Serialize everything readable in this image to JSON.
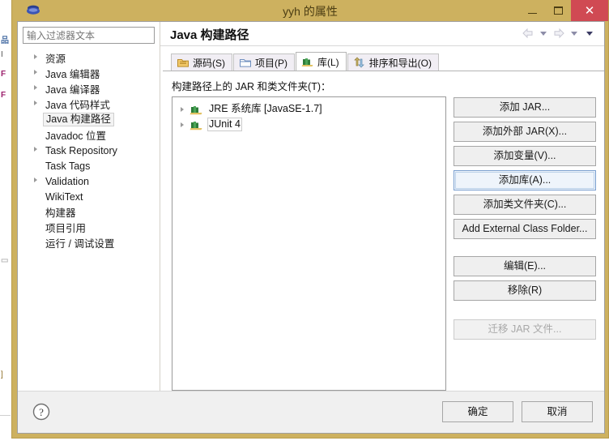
{
  "window": {
    "title": "yyh 的属性",
    "icon": "eclipse-icon",
    "controls": {
      "minimize": "–",
      "maximize": "□",
      "close": "✕"
    },
    "colors": {
      "titlebar": "#CDB15F",
      "close_button": "#D04A53",
      "client": "#F0F0F0",
      "focus_border": "#7A9FCF"
    }
  },
  "background_fragments": [
    "品",
    "I",
    "F",
    "F",
    "▭",
    "]"
  ],
  "sidebar": {
    "filter": {
      "placeholder": "输入过滤器文本",
      "value": ""
    },
    "items": [
      {
        "label": "资源",
        "expandable": true,
        "selected": false
      },
      {
        "label": "Java 编辑器",
        "expandable": true,
        "selected": false
      },
      {
        "label": "Java 编译器",
        "expandable": true,
        "selected": false
      },
      {
        "label": "Java 代码样式",
        "expandable": true,
        "selected": false
      },
      {
        "label": "Java 构建路径",
        "expandable": false,
        "selected": true
      },
      {
        "label": "Javadoc 位置",
        "expandable": false,
        "selected": false
      },
      {
        "label": "Task Repository",
        "expandable": true,
        "selected": false
      },
      {
        "label": "Task Tags",
        "expandable": false,
        "selected": false
      },
      {
        "label": "Validation",
        "expandable": true,
        "selected": false
      },
      {
        "label": "WikiText",
        "expandable": false,
        "selected": false
      },
      {
        "label": "构建器",
        "expandable": false,
        "selected": false
      },
      {
        "label": "项目引用",
        "expandable": false,
        "selected": false
      },
      {
        "label": "运行 / 调试设置",
        "expandable": false,
        "selected": false
      }
    ]
  },
  "page": {
    "title": "Java 构建路径",
    "nav": {
      "back": "back-arrow-icon",
      "back_menu": "chevron-down-icon",
      "forward": "forward-arrow-icon",
      "forward_menu": "chevron-down-icon",
      "view_menu": "chevron-down-icon"
    },
    "tabs": [
      {
        "label": "源码(S)",
        "icon": "source-folder-icon",
        "active": false
      },
      {
        "label": "项目(P)",
        "icon": "project-icon",
        "active": false
      },
      {
        "label": "库(L)",
        "icon": "library-icon",
        "active": true
      },
      {
        "label": "排序和导出(O)",
        "icon": "order-export-icon",
        "active": false
      }
    ],
    "section_label": "构建路径上的 JAR 和类文件夹(T)：",
    "libraries": [
      {
        "label": "JRE 系统库 [JavaSE-1.7]",
        "icon": "library-icon",
        "expandable": true,
        "focused": false
      },
      {
        "label": "JUnit 4",
        "icon": "library-icon",
        "expandable": true,
        "focused": true
      }
    ],
    "buttons": [
      {
        "label": "添加 JAR...",
        "state": "normal",
        "group": 1
      },
      {
        "label": "添加外部 JAR(X)...",
        "state": "normal",
        "group": 1
      },
      {
        "label": "添加变量(V)...",
        "state": "normal",
        "group": 1
      },
      {
        "label": "添加库(A)...",
        "state": "focused",
        "group": 1
      },
      {
        "label": "添加类文件夹(C)...",
        "state": "normal",
        "group": 1
      },
      {
        "label": "Add External Class Folder...",
        "state": "normal",
        "group": 1
      },
      {
        "label": "编辑(E)...",
        "state": "normal",
        "group": 2
      },
      {
        "label": "移除(R)",
        "state": "normal",
        "group": 2
      },
      {
        "label": "迁移 JAR 文件...",
        "state": "disabled",
        "group": 3
      }
    ]
  },
  "footer": {
    "help_icon": "help-question-icon",
    "ok_label": "确定",
    "cancel_label": "取消"
  }
}
